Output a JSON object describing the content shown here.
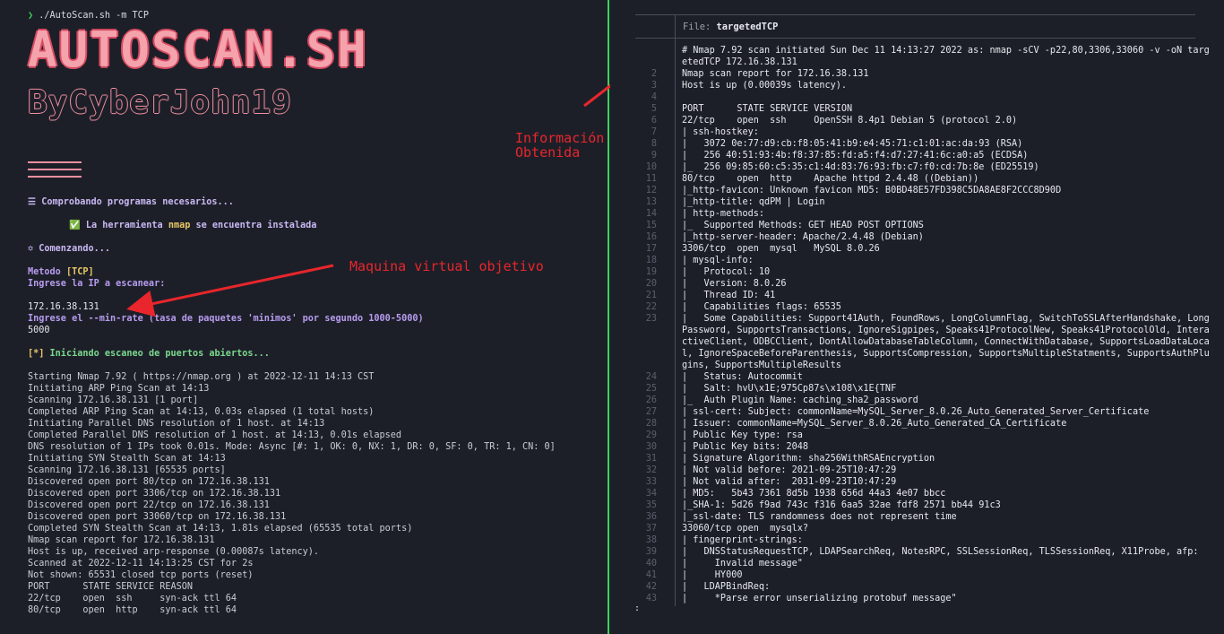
{
  "left": {
    "prompt_arrow": "❯",
    "prompt_cmd": "./AutoScan.sh -m TCP",
    "banner_title": "AUTOSCAN.SH",
    "banner_sub": "ByCyberJohn19",
    "checking": "☰ Comprobando programas necesarios...",
    "installed_pre": "✅ La herramienta ",
    "installed_tool": "nmap",
    "installed_post": " se encuentra instalada",
    "starting": "✡ Comenzando...",
    "method_label": "Metodo ",
    "method_value": "[TCP]",
    "ask_ip": "Ingrese la IP a escanear:",
    "ip_value": "172.16.38.131",
    "ask_rate": "Ingrese el --min-rate (tasa de paquetes 'minimos' por segundo 1000-5000)",
    "rate_value": "5000",
    "scan_start": "[*] Iniciando escaneo de puertos abiertos...",
    "nmap_output": [
      "Starting Nmap 7.92 ( https://nmap.org ) at 2022-12-11 14:13 CST",
      "Initiating ARP Ping Scan at 14:13",
      "Scanning 172.16.38.131 [1 port]",
      "Completed ARP Ping Scan at 14:13, 0.03s elapsed (1 total hosts)",
      "Initiating Parallel DNS resolution of 1 host. at 14:13",
      "Completed Parallel DNS resolution of 1 host. at 14:13, 0.01s elapsed",
      "DNS resolution of 1 IPs took 0.01s. Mode: Async [#: 1, OK: 0, NX: 1, DR: 0, SF: 0, TR: 1, CN: 0]",
      "Initiating SYN Stealth Scan at 14:13",
      "Scanning 172.16.38.131 [65535 ports]",
      "Discovered open port 80/tcp on 172.16.38.131",
      "Discovered open port 3306/tcp on 172.16.38.131",
      "Discovered open port 22/tcp on 172.16.38.131",
      "Discovered open port 33060/tcp on 172.16.38.131",
      "Completed SYN Stealth Scan at 14:13, 1.81s elapsed (65535 total ports)",
      "Nmap scan report for 172.16.38.131",
      "Host is up, received arp-response (0.00087s latency).",
      "Scanned at 2022-12-11 14:13:25 CST for 2s",
      "Not shown: 65531 closed tcp ports (reset)",
      "PORT      STATE SERVICE REASON",
      "22/tcp    open  ssh     syn-ack ttl 64",
      "80/tcp    open  http    syn-ack ttl 64"
    ]
  },
  "notes": {
    "info": "Información\nObtenida",
    "target": "Maquina virtual objetivo"
  },
  "right": {
    "file_label": "File: ",
    "file_name": "targetedTCP",
    "lines": [
      {
        "n": "",
        "t": "# Nmap 7.92 scan initiated Sun Dec 11 14:13:27 2022 as: nmap -sCV -p22,80,3306,33060 -v -oN targ"
      },
      {
        "n": "",
        "t": "etedTCP 172.16.38.131"
      },
      {
        "n": "2",
        "t": "Nmap scan report for 172.16.38.131"
      },
      {
        "n": "3",
        "t": "Host is up (0.00039s latency)."
      },
      {
        "n": "4",
        "t": ""
      },
      {
        "n": "5",
        "t": "PORT      STATE SERVICE VERSION"
      },
      {
        "n": "6",
        "t": "22/tcp    open  ssh     OpenSSH 8.4p1 Debian 5 (protocol 2.0)"
      },
      {
        "n": "7",
        "t": "| ssh-hostkey:"
      },
      {
        "n": "8",
        "t": "|   3072 0e:77:d9:cb:f8:05:41:b9:e4:45:71:c1:01:ac:da:93 (RSA)"
      },
      {
        "n": "9",
        "t": "|   256 40:51:93:4b:f8:37:85:fd:a5:f4:d7:27:41:6c:a0:a5 (ECDSA)"
      },
      {
        "n": "10",
        "t": "|_  256 09:85:60:c5:35:c1:4d:83:76:93:fb:c7:f0:cd:7b:8e (ED25519)"
      },
      {
        "n": "11",
        "t": "80/tcp    open  http    Apache httpd 2.4.48 ((Debian))"
      },
      {
        "n": "12",
        "t": "|_http-favicon: Unknown favicon MD5: B0BD48E57FD398C5DA8AE8F2CCC8D90D"
      },
      {
        "n": "13",
        "t": "|_http-title: qdPM | Login"
      },
      {
        "n": "14",
        "t": "| http-methods:"
      },
      {
        "n": "15",
        "t": "|_  Supported Methods: GET HEAD POST OPTIONS"
      },
      {
        "n": "16",
        "t": "|_http-server-header: Apache/2.4.48 (Debian)"
      },
      {
        "n": "17",
        "t": "3306/tcp  open  mysql   MySQL 8.0.26"
      },
      {
        "n": "18",
        "t": "| mysql-info:"
      },
      {
        "n": "19",
        "t": "|   Protocol: 10"
      },
      {
        "n": "20",
        "t": "|   Version: 8.0.26"
      },
      {
        "n": "21",
        "t": "|   Thread ID: 41"
      },
      {
        "n": "22",
        "t": "|   Capabilities flags: 65535"
      },
      {
        "n": "23",
        "t": "|   Some Capabilities: Support41Auth, FoundRows, LongColumnFlag, SwitchToSSLAfterHandshake, Long"
      },
      {
        "n": "",
        "t": "Password, SupportsTransactions, IgnoreSigpipes, Speaks41ProtocolNew, Speaks41ProtocolOld, Intera"
      },
      {
        "n": "",
        "t": "ctiveClient, ODBCClient, DontAllowDatabaseTableColumn, ConnectWithDatabase, SupportsLoadDataLoca"
      },
      {
        "n": "",
        "t": "l, IgnoreSpaceBeforeParenthesis, SupportsCompression, SupportsMultipleStatments, SupportsAuthPlu"
      },
      {
        "n": "",
        "t": "gins, SupportsMultipleResults"
      },
      {
        "n": "24",
        "t": "|   Status: Autocommit"
      },
      {
        "n": "25",
        "t": "|   Salt: hvU\\x1E;975Cp87s\\x108\\x1E{TNF"
      },
      {
        "n": "26",
        "t": "|_  Auth Plugin Name: caching_sha2_password"
      },
      {
        "n": "27",
        "t": "| ssl-cert: Subject: commonName=MySQL_Server_8.0.26_Auto_Generated_Server_Certificate"
      },
      {
        "n": "28",
        "t": "| Issuer: commonName=MySQL_Server_8.0.26_Auto_Generated_CA_Certificate"
      },
      {
        "n": "29",
        "t": "| Public Key type: rsa"
      },
      {
        "n": "30",
        "t": "| Public Key bits: 2048"
      },
      {
        "n": "31",
        "t": "| Signature Algorithm: sha256WithRSAEncryption"
      },
      {
        "n": "32",
        "t": "| Not valid before: 2021-09-25T10:47:29"
      },
      {
        "n": "33",
        "t": "| Not valid after:  2031-09-23T10:47:29"
      },
      {
        "n": "34",
        "t": "| MD5:   5b43 7361 8d5b 1938 656d 44a3 4e07 bbcc"
      },
      {
        "n": "35",
        "t": "|_SHA-1: 5d26 f9ad 743c f316 6aa5 32ae fdf8 2571 bb44 91c3"
      },
      {
        "n": "36",
        "t": "|_ssl-date: TLS randomness does not represent time"
      },
      {
        "n": "37",
        "t": "33060/tcp open  mysqlx?"
      },
      {
        "n": "38",
        "t": "| fingerprint-strings:"
      },
      {
        "n": "39",
        "t": "|   DNSStatusRequestTCP, LDAPSearchReq, NotesRPC, SSLSessionReq, TLSSessionReq, X11Probe, afp:"
      },
      {
        "n": "40",
        "t": "|     Invalid message\""
      },
      {
        "n": "41",
        "t": "|     HY000"
      },
      {
        "n": "42",
        "t": "|   LDAPBindReq:"
      },
      {
        "n": "43",
        "t": "|     *Parse error unserializing protobuf message\""
      }
    ],
    "pager_prompt": ":"
  }
}
